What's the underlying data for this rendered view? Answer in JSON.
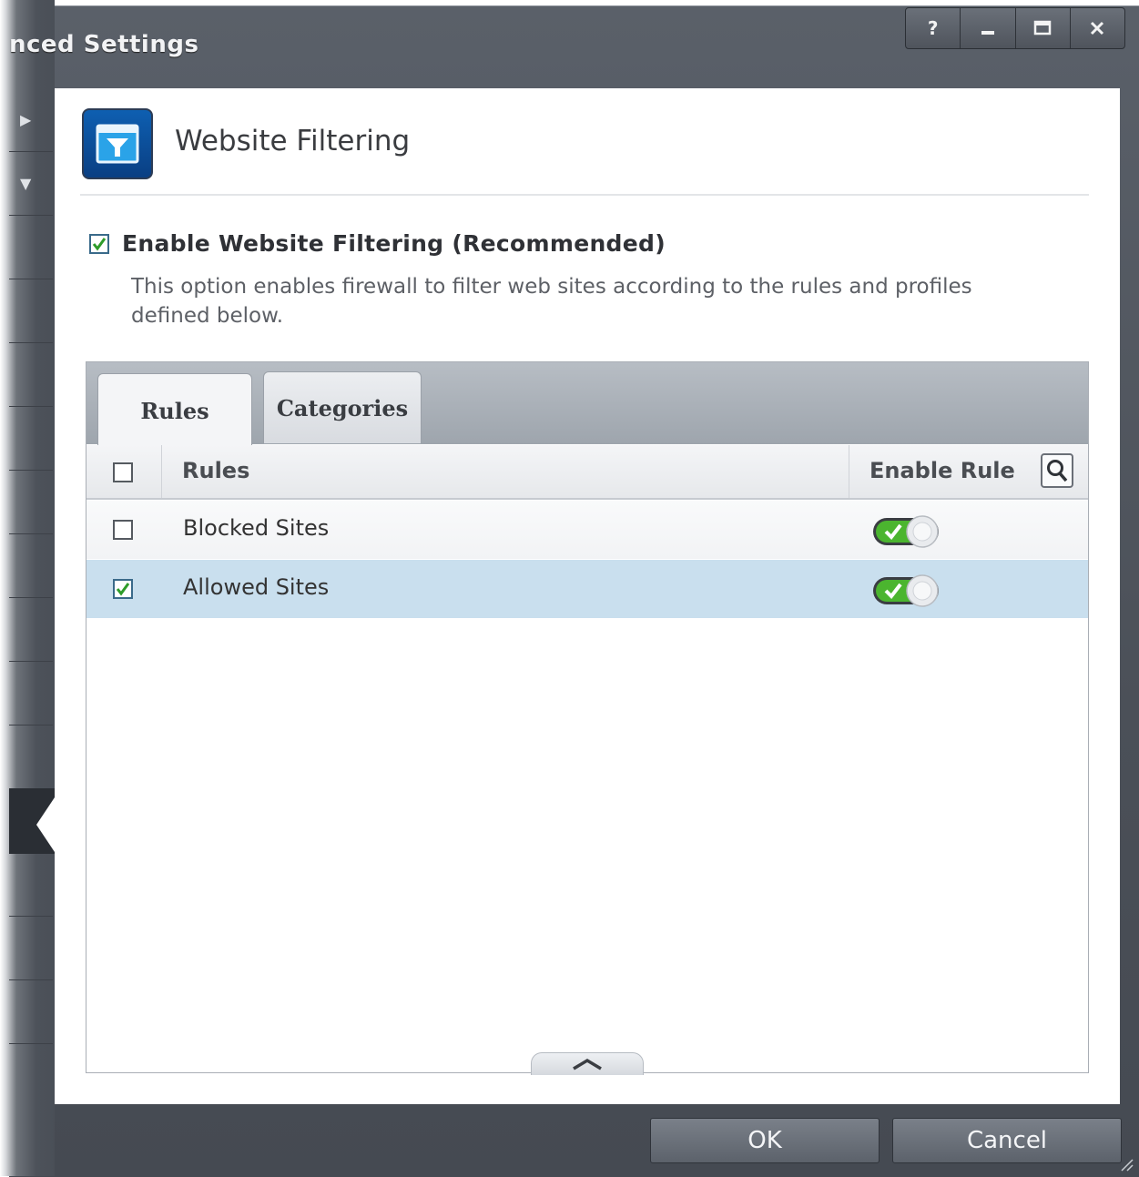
{
  "window": {
    "title": "nced Settings",
    "buttons": {
      "help": "?",
      "minimize": "–",
      "maximize": "☐",
      "close": "×"
    }
  },
  "header": {
    "title": "Website Filtering",
    "icon": "funnel-filter-icon",
    "icon_color": "#0e5fb1"
  },
  "enable": {
    "checked": true,
    "label": "Enable Website Filtering (Recommended)",
    "description": "This option enables firewall to filter web sites according to the rules and profiles defined below."
  },
  "tabs": [
    {
      "label": "Rules",
      "active": true
    },
    {
      "label": "Categories",
      "active": false
    }
  ],
  "table": {
    "columns": {
      "rules": "Rules",
      "enable_rule": "Enable Rule"
    },
    "rows": [
      {
        "name": "Blocked Sites",
        "checked": false,
        "enabled": true,
        "selected": false
      },
      {
        "name": "Allowed Sites",
        "checked": true,
        "enabled": true,
        "selected": true
      }
    ],
    "selected_row_color": "#c9dfee"
  },
  "footer": {
    "ok": "OK",
    "cancel": "Cancel"
  },
  "colors": {
    "toggle_on": "#3fa52a",
    "chrome": "#4b5058"
  }
}
